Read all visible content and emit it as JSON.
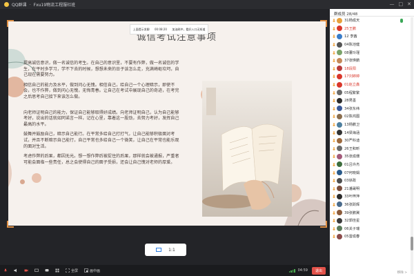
{
  "window": {
    "app_name": "QQ群课",
    "subtitle": "Fxu19物流工程服社班",
    "controls": [
      "—",
      "□",
      "✕"
    ]
  },
  "slide": {
    "banner_left": "上面提示发聊",
    "banner_mid": "00:08:20",
    "banner_right": "加油刷冲，看好入口无知道",
    "title": "诚信考试注意事项",
    "paragraphs": [
      "提高诚信意识，做一名诚信的考生。在自己的意识里，不要有作弊，做一名诚信的学生，在平时多学习，学不下去的时候，想想未来的日子该怎么走，充满崎岖坎坷，自己现在需要努力。",
      "相信自己的能力及水平，做到问心无愧。相信自己，给自己一个心理暗示，即使不会，也不作弊，做到问心无愧，无悔青春。让自己在考试中展现自己的奇迹，在考完之后思考自己接下来该怎么做。",
      "向老师证明自己的能力，保证自己能够取得好成绩。向老师证明自己，认为自己能够考好，说出的话就如同诺言一样，记在心里，靠着这一股劲，去努力考好，发挥自己最高的水平。",
      "鼓舞并鼓励自己，暗示自己能行。在平常多给自己打打气，让自己能够积极面对考试，并且不断暗示自己能行，自己平常也多给自己一个微笑，让自己在平常也能乐观的面对生活。",
      "考虑作弊的后果，都因无光。想一想作弊后被捉住的后果，那样就会被通报，严重者可能会面临一些责任，总之会使得自己的面子受损，还会让自己愧对老师的厚爱。"
    ]
  },
  "zoom": {
    "label": "1:1"
  },
  "toolbar": {
    "fullscreen_label": "全屏",
    "pip_label": "画中画",
    "time": "04:59",
    "leave_label": "退出"
  },
  "members_panel": {
    "header": "群成员 28/48",
    "members": [
      {
        "name": "31杨成天",
        "color": "#e8a13c",
        "mic": true
      },
      {
        "name": "25王鹏",
        "color": "#d9372b",
        "red": true
      },
      {
        "name": "12 李茜",
        "color": "#3a7dc9"
      },
      {
        "name": "04陈池健",
        "color": "#555"
      },
      {
        "name": "08董玲瑾",
        "color": "#7aa36a"
      },
      {
        "name": "37张瑛鹏",
        "color": "#c58a5a"
      },
      {
        "name": "18段阳",
        "color": "#b83c3c",
        "red": true
      },
      {
        "name": "17刘婷婷",
        "color": "#d9372b",
        "red": true
      },
      {
        "name": "01赵立鑫",
        "color": "#d9372b",
        "red": true
      },
      {
        "name": "05程繁繁",
        "color": "#6a6a6a"
      },
      {
        "name": "28男墨",
        "color": "#2d2d2d"
      },
      {
        "name": "34张东纬",
        "color": "#3b5998"
      },
      {
        "name": "02陈鸿图",
        "color": "#8a6d4e"
      },
      {
        "name": "13杨鹏卫",
        "color": "#4e7f9e"
      },
      {
        "name": "14梁海涵",
        "color": "#333"
      },
      {
        "name": "30严科迪",
        "color": "#9e6b3f"
      },
      {
        "name": "26王和昕",
        "color": "#6a6a6a"
      },
      {
        "name": "35张成珊",
        "color": "#a35a7a"
      },
      {
        "name": "01吕许杰",
        "color": "#3d6d3d"
      },
      {
        "name": "07何晓娟",
        "color": "#2a5a8a"
      },
      {
        "name": "03徐政",
        "color": "#4e4e4e"
      },
      {
        "name": "21潘晟明",
        "color": "#7a4e3e"
      },
      {
        "name": "33叶梓萍",
        "color": "#2b2b2b"
      },
      {
        "name": "36张跃辉",
        "color": "#4b6b8b"
      },
      {
        "name": "39张鹏冀",
        "color": "#8b5b3b"
      },
      {
        "name": "32郭佳星",
        "color": "#3b3b3b"
      },
      {
        "name": "06关子瑞",
        "color": "#5b7b5b"
      },
      {
        "name": "05雷成春",
        "color": "#8b4b4b"
      }
    ],
    "footer": "移除 >"
  },
  "colors": {
    "accent_orange": "#e09045",
    "leave_red": "#e2524a",
    "slide_bg": "#f6f1ed"
  }
}
